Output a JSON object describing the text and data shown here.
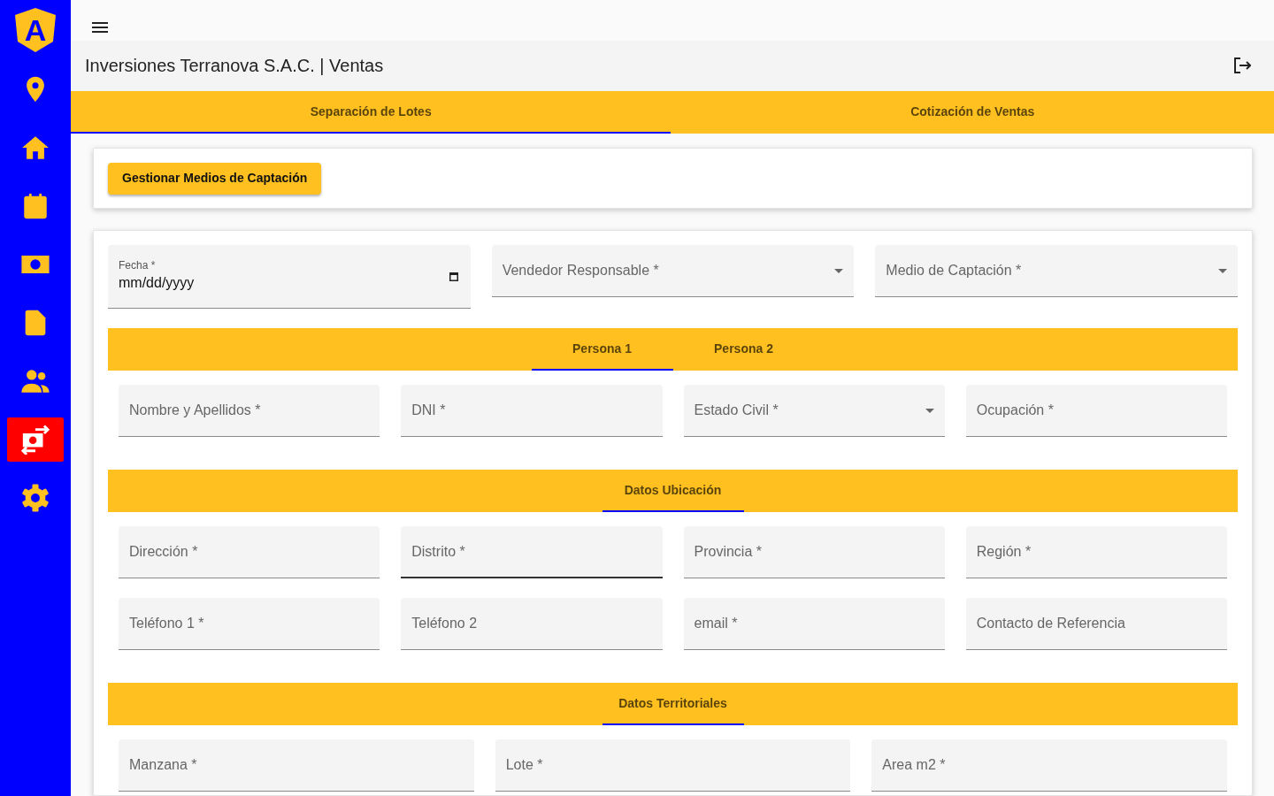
{
  "sidebar": {
    "logo_letter": "A",
    "items": [
      {
        "selected": false
      },
      {
        "selected": false
      },
      {
        "selected": false
      },
      {
        "selected": false
      },
      {
        "selected": false
      },
      {
        "selected": false
      },
      {
        "selected": true
      },
      {
        "selected": false
      }
    ]
  },
  "header": {
    "title": "Inversiones Terranova S.A.C. | Ventas"
  },
  "tabs": [
    {
      "label": "Separación de Lotes",
      "selected": true
    },
    {
      "label": "Cotización de Ventas",
      "selected": false
    }
  ],
  "actions_card": {
    "button": "Gestionar Medios de Captación"
  },
  "form": {
    "top_fields": [
      {
        "kind": "date",
        "label": "Fecha *",
        "value": "mm/dd/yyyy",
        "focused": false
      },
      {
        "kind": "select",
        "label": "Vendedor Responsable *",
        "focused": false
      },
      {
        "kind": "select",
        "label": "Medio de Captación *",
        "focused": false
      }
    ],
    "sections": [
      {
        "tabs": [
          {
            "label": "Persona 1",
            "selected": true
          },
          {
            "label": "Persona 2",
            "selected": false
          }
        ],
        "rows": [
          [
            {
              "kind": "text",
              "label": "Nombre y Apellidos *",
              "focused": false
            },
            {
              "kind": "text",
              "label": "DNI *",
              "focused": false
            },
            {
              "kind": "select",
              "label": "Estado Civil *",
              "focused": false
            },
            {
              "kind": "text",
              "label": "Ocupación *",
              "focused": false
            }
          ]
        ]
      },
      {
        "tabs": [
          {
            "label": "Datos Ubicación",
            "selected": true
          }
        ],
        "rows": [
          [
            {
              "kind": "text",
              "label": "Dirección *",
              "focused": false
            },
            {
              "kind": "text",
              "label": "Distrito *",
              "focused": true
            },
            {
              "kind": "text",
              "label": "Provincia *",
              "focused": false
            },
            {
              "kind": "text",
              "label": "Región *",
              "focused": false
            }
          ],
          [
            {
              "kind": "text",
              "label": "Teléfono 1 *",
              "focused": false
            },
            {
              "kind": "text",
              "label": "Teléfono 2",
              "focused": false
            },
            {
              "kind": "text",
              "label": "email *",
              "focused": false
            },
            {
              "kind": "text",
              "label": "Contacto de Referencia",
              "focused": false
            }
          ]
        ]
      },
      {
        "tabs": [
          {
            "label": "Datos Territoriales",
            "selected": true
          }
        ],
        "rows": [
          [
            {
              "kind": "text",
              "label": "Manzana *"
            },
            {
              "kind": "text",
              "label": "Lote *"
            },
            {
              "kind": "text",
              "label": "Area m2 *"
            }
          ]
        ]
      }
    ]
  }
}
